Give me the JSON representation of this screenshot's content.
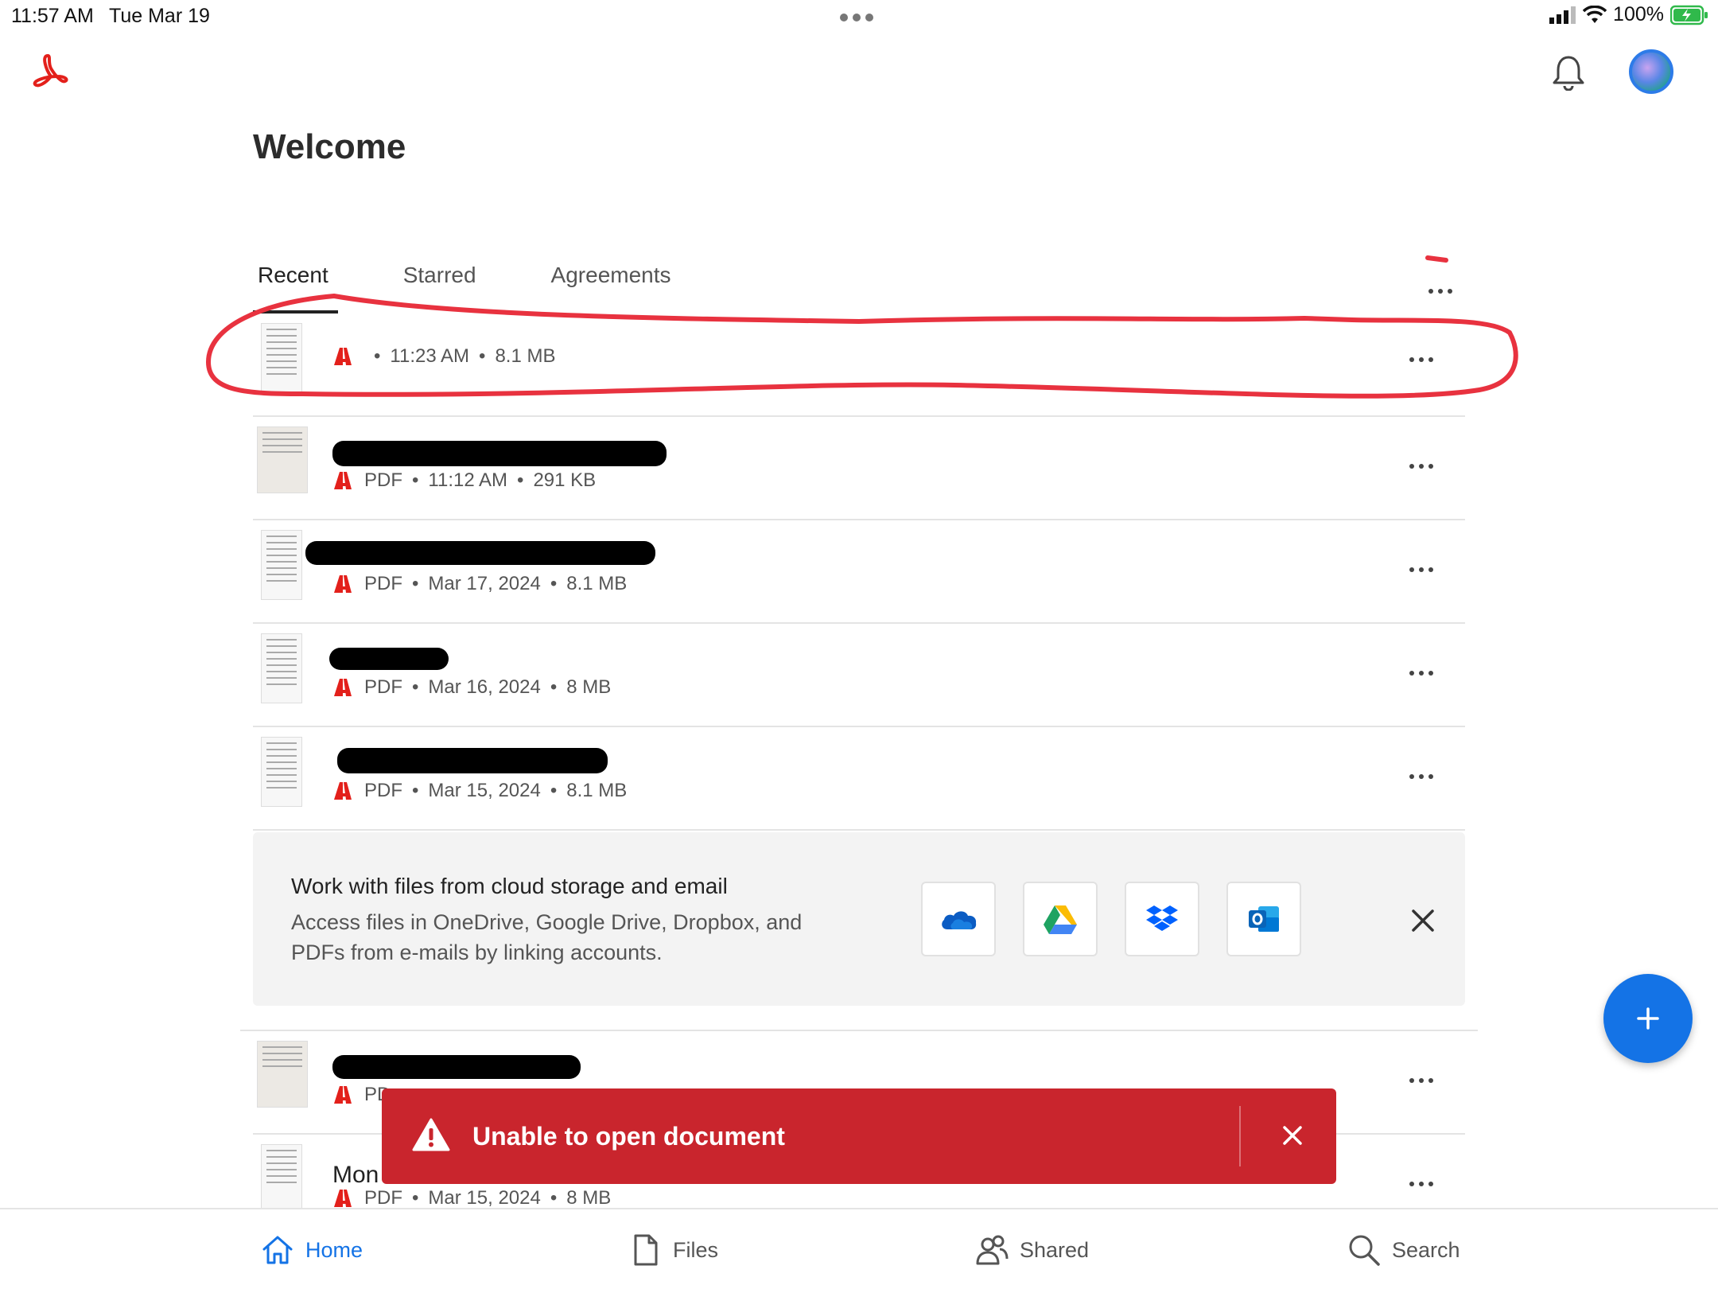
{
  "status_bar": {
    "time": "11:57 AM",
    "date": "Tue Mar 19",
    "battery": "100%"
  },
  "page_title": "Welcome",
  "tabs": [
    {
      "label": "Recent",
      "active": true
    },
    {
      "label": "Starred",
      "active": false
    },
    {
      "label": "Agreements",
      "active": false
    }
  ],
  "files": [
    {
      "name": "",
      "type": "",
      "date": "11:23 AM",
      "size": "8.1 MB"
    },
    {
      "name": "",
      "type": "PDF",
      "date": "11:12 AM",
      "size": "291 KB"
    },
    {
      "name": "",
      "type": "PDF",
      "date": "Mar 17, 2024",
      "size": "8.1 MB"
    },
    {
      "name": "",
      "type": "PDF",
      "date": "Mar 16, 2024",
      "size": "8 MB"
    },
    {
      "name": "",
      "type": "PDF",
      "date": "Mar 15, 2024",
      "size": "8.1 MB"
    }
  ],
  "promo": {
    "title": "Work with files from cloud storage and email",
    "body": "Access files in OneDrive, Google Drive, Dropbox, and PDFs from e-mails by linking accounts.",
    "services": [
      "onedrive-icon",
      "google-drive-icon",
      "dropbox-icon",
      "outlook-icon"
    ]
  },
  "files_below": [
    {
      "name": "",
      "type": "PD",
      "date": "",
      "size": ""
    },
    {
      "name": "Mon",
      "type": "PDF",
      "date": "Mar 15, 2024",
      "size": "8 MB"
    }
  ],
  "toast": {
    "message": "Unable to open document"
  },
  "bottom_nav": [
    {
      "label": "Home",
      "icon": "home-icon",
      "active": true
    },
    {
      "label": "Files",
      "icon": "file-icon",
      "active": false
    },
    {
      "label": "Shared",
      "icon": "people-icon",
      "active": false
    },
    {
      "label": "Search",
      "icon": "search-icon",
      "active": false
    }
  ],
  "colors": {
    "accent": "#1473e6",
    "error": "#c9252d",
    "acrobat_red": "#e3201b",
    "annotation": "#e8323f"
  }
}
